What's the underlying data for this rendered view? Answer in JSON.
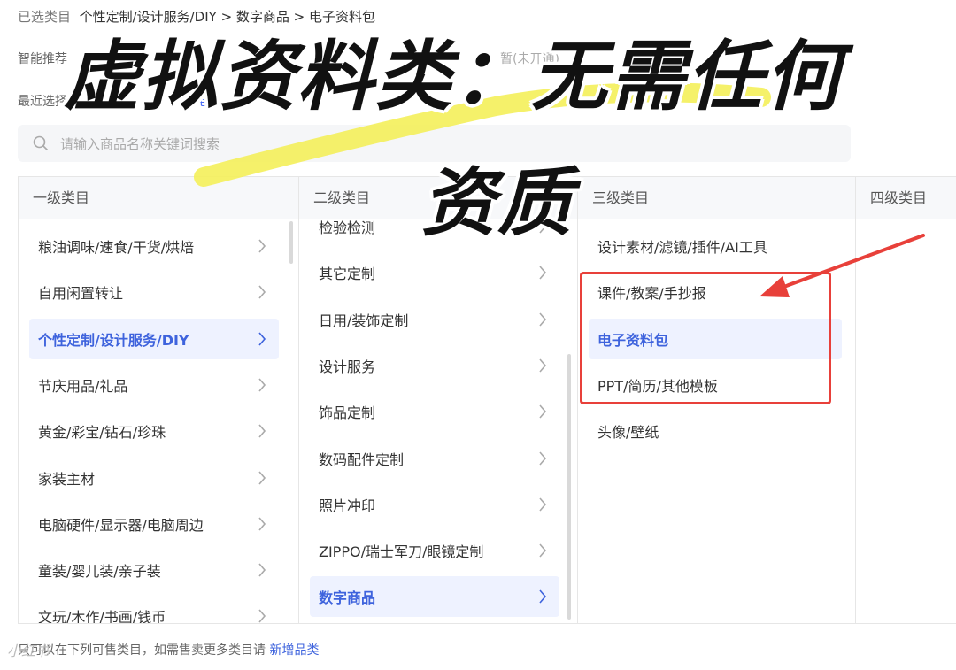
{
  "breadcrumb": {
    "prefix": "已选类目",
    "path": "个性定制/设计服务/DIY > 数字商品 > 电子资料包"
  },
  "smart_recommend": {
    "label": "智能推荐",
    "hint": "暂(未开通)"
  },
  "recent": {
    "label": "最近选择",
    "link": "电子"
  },
  "search": {
    "placeholder": "请输入商品名称关键词搜索"
  },
  "columns": {
    "level1": {
      "header": "一级类目",
      "items": [
        "粮油调味/速食/干货/烘焙",
        "自用闲置转让",
        "个性定制/设计服务/DIY",
        "节庆用品/礼品",
        "黄金/彩宝/钻石/珍珠",
        "家装主材",
        "电脑硬件/显示器/电脑周边",
        "童装/婴儿装/亲子装",
        "文玩/木作/书画/钱币"
      ],
      "selected_index": 2
    },
    "level2": {
      "header": "二级类目",
      "items": [
        "检验检测",
        "其它定制",
        "日用/装饰定制",
        "设计服务",
        "饰品定制",
        "数码配件定制",
        "照片冲印",
        "ZIPPO/瑞士军刀/眼镜定制",
        "数字商品"
      ],
      "selected_index": 8
    },
    "level3": {
      "header": "三级类目",
      "items": [
        "设计素材/滤镜/插件/AI工具",
        "课件/教案/手抄报",
        "电子资料包",
        "PPT/简历/其他模板",
        "头像/壁纸"
      ],
      "selected_index": 2
    },
    "level4": {
      "header": "四级类目"
    }
  },
  "footer": {
    "text": "只可以在下列可售类目，如需售卖更多类目请",
    "link": "新增品类"
  },
  "overlay": {
    "line1": "虚拟资料类：无需任何",
    "line2": "资质"
  },
  "watermark": "小红书",
  "colors": {
    "accent": "#3e63dd",
    "highlight_marker": "#f4f05a",
    "annotation_red": "#e8403a"
  }
}
